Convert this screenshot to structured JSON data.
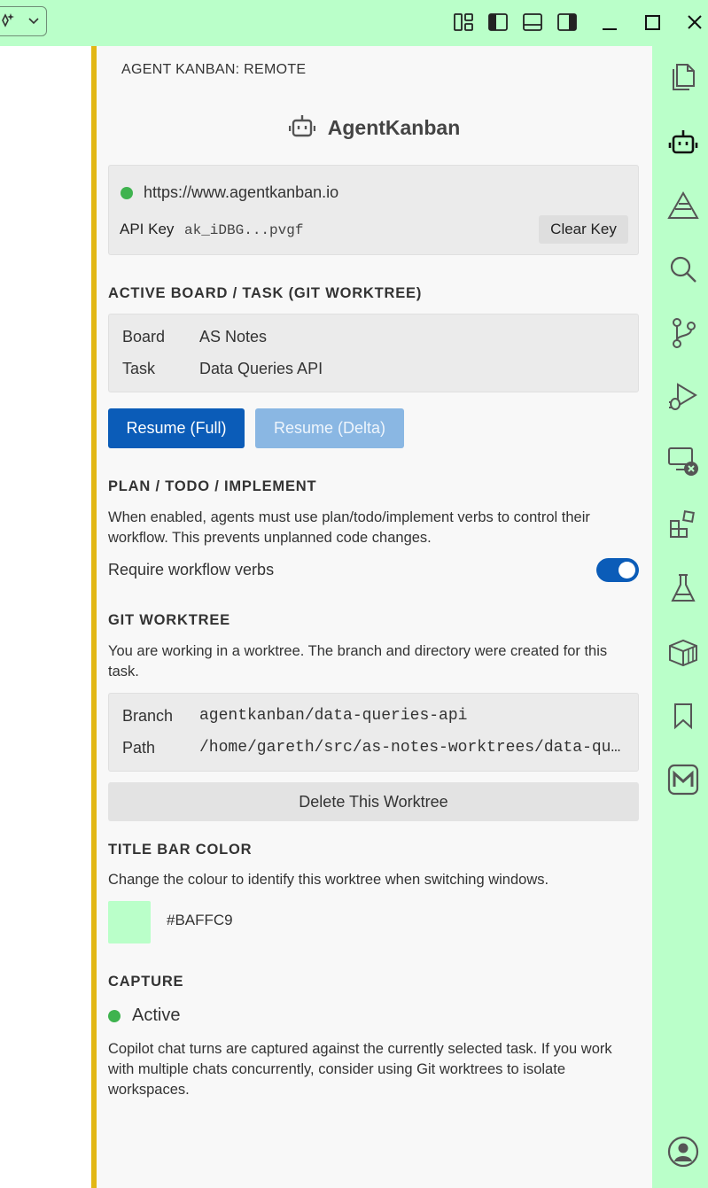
{
  "titlebar": {
    "icons": [
      "sparkle-icon",
      "chevron-down-icon",
      "customize-layout-icon",
      "toggle-primary-sidebar-icon",
      "toggle-panel-icon",
      "toggle-secondary-sidebar-icon",
      "minimize-icon",
      "maximize-icon",
      "close-icon"
    ],
    "background": "#BAFFC9"
  },
  "panel": {
    "header": "AGENT KANBAN: REMOTE",
    "brand_name": "AgentKanban",
    "connection": {
      "url": "https://www.agentkanban.io",
      "status_color": "#3fb34f",
      "api_key_label": "API Key",
      "api_key_value": "ak_iDBG...pvgf",
      "clear_key_label": "Clear Key"
    },
    "active_board": {
      "heading": "ACTIVE BOARD / TASK (GIT WORKTREE)",
      "board_label": "Board",
      "board_value": "AS Notes",
      "task_label": "Task",
      "task_value": "Data Queries API",
      "resume_full_label": "Resume (Full)",
      "resume_delta_label": "Resume (Delta)"
    },
    "plan": {
      "heading": "PLAN / TODO / IMPLEMENT",
      "description": "When enabled, agents must use plan/todo/implement verbs to control their workflow. This prevents unplanned code changes.",
      "toggle_label": "Require workflow verbs",
      "toggle_on": true
    },
    "worktree": {
      "heading": "GIT WORKTREE",
      "description": "You are working in a worktree. The branch and directory were created for this task.",
      "branch_label": "Branch",
      "branch_value": "agentkanban/data-queries-api",
      "path_label": "Path",
      "path_value": "/home/gareth/src/as-notes-worktrees/data-qu…",
      "delete_label": "Delete This Worktree"
    },
    "titlebar_color": {
      "heading": "TITLE BAR COLOR",
      "description": "Change the colour to identify this worktree when switching windows.",
      "hex": "#BAFFC9"
    },
    "capture": {
      "heading": "CAPTURE",
      "status": "Active",
      "description": "Copilot chat turns are captured against the currently selected task. If you work with multiple chats concurrently, consider using Git worktrees to isolate workspaces."
    }
  },
  "activity_bar": {
    "icons": [
      "explorer-icon",
      "agent-kanban-robot-icon",
      "testing-triangle-icon",
      "search-icon",
      "source-control-icon",
      "run-debug-icon",
      "remote-explorer-icon",
      "extensions-icon",
      "flask-icon",
      "containers-icon",
      "bookmarks-icon",
      "markdown-icon",
      "accounts-icon"
    ]
  }
}
